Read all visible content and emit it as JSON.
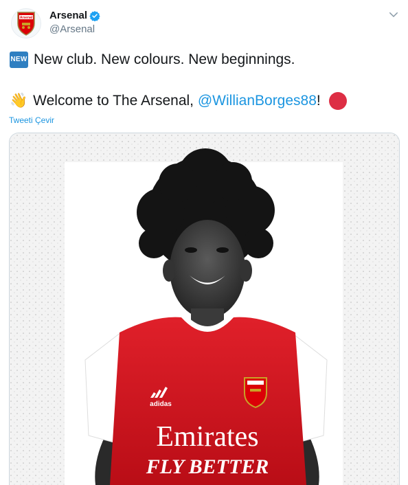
{
  "account": {
    "display_name": "Arsenal",
    "handle": "@Arsenal",
    "verified": true,
    "crest_text": "Arsenal"
  },
  "tweet": {
    "line1": {
      "badge": "NEW",
      "text": "New club. New colours. New beginnings."
    },
    "line2": {
      "emoji": "👋",
      "prefix": "Welcome to The Arsenal, ",
      "mention": "@WillianBorges88",
      "suffix": "!"
    },
    "translate_label": "Tweeti Çevir"
  },
  "media": {
    "shirt_sponsor": "Emirates",
    "shirt_slogan": "FLY BETTER",
    "shirt_brand": "adidas"
  },
  "colors": {
    "link": "#1b95e0",
    "arsenal_red": "#db0007",
    "verified": "#1da1f2",
    "badge_blue": "#2f7fc1",
    "red_circle": "#dd2e44"
  },
  "icons": {
    "avatar": "arsenal-crest-icon",
    "verified": "verified-badge-icon",
    "menu": "chevron-down-icon",
    "badge": "new-button-emoji",
    "wave": "waving-hand-emoji",
    "circle": "red-circle-emoji"
  }
}
